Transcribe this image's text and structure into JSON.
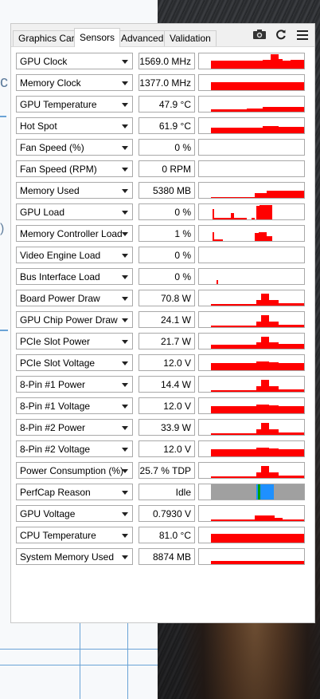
{
  "window": {
    "tabs": [
      "Graphics Card",
      "Sensors",
      "Advanced",
      "Validation"
    ],
    "active_tab": "Sensors",
    "toolbar_icons": [
      "camera-icon",
      "refresh-icon",
      "menu-icon"
    ]
  },
  "sensors": [
    {
      "label": "GPU Clock",
      "value": "1569.0 MHz",
      "graph": "spike-high"
    },
    {
      "label": "Memory Clock",
      "value": "1377.0 MHz",
      "graph": "full"
    },
    {
      "label": "GPU Temperature",
      "value": "47.9 °C",
      "graph": "low-rise"
    },
    {
      "label": "Hot Spot",
      "value": "61.9 °C",
      "graph": "mid-flat"
    },
    {
      "label": "Fan Speed (%)",
      "value": "0 %",
      "graph": "empty"
    },
    {
      "label": "Fan Speed (RPM)",
      "value": "0 RPM",
      "graph": "empty"
    },
    {
      "label": "Memory Used",
      "value": "5380 MB",
      "graph": "mem"
    },
    {
      "label": "GPU Load",
      "value": "0 %",
      "graph": "load"
    },
    {
      "label": "Memory Controller Load",
      "value": "1 %",
      "graph": "mcload"
    },
    {
      "label": "Video Engine Load",
      "value": "0 %",
      "graph": "empty"
    },
    {
      "label": "Bus Interface Load",
      "value": "0 %",
      "graph": "dot"
    },
    {
      "label": "Board Power Draw",
      "value": "70.8 W",
      "graph": "power"
    },
    {
      "label": "GPU Chip Power Draw",
      "value": "24.1 W",
      "graph": "power"
    },
    {
      "label": "PCIe Slot Power",
      "value": "21.7 W",
      "graph": "power2"
    },
    {
      "label": "PCIe Slot Voltage",
      "value": "12.0 V",
      "graph": "volt"
    },
    {
      "label": "8-Pin #1 Power",
      "value": "14.4 W",
      "graph": "power"
    },
    {
      "label": "8-Pin #1 Voltage",
      "value": "12.0 V",
      "graph": "volt"
    },
    {
      "label": "8-Pin #2 Power",
      "value": "33.9 W",
      "graph": "power"
    },
    {
      "label": "8-Pin #2 Voltage",
      "value": "12.0 V",
      "graph": "volt"
    },
    {
      "label": "Power Consumption (%)",
      "value": "25.7 % TDP",
      "graph": "power"
    },
    {
      "label": "PerfCap Reason",
      "value": "Idle",
      "graph": "perfcap"
    },
    {
      "label": "GPU Voltage",
      "value": "0.7930 V",
      "graph": "gpuvolt"
    },
    {
      "label": "CPU Temperature",
      "value": "81.0 °C",
      "graph": "cputemp"
    },
    {
      "label": "System Memory Used",
      "value": "8874 MB",
      "graph": "sysmem"
    }
  ],
  "colors": {
    "graph": "#ff0000",
    "perfcap_idle": "#a0a0a0",
    "perfcap_util": "#1e90ff",
    "perfcap_vrel": "#00a000"
  }
}
